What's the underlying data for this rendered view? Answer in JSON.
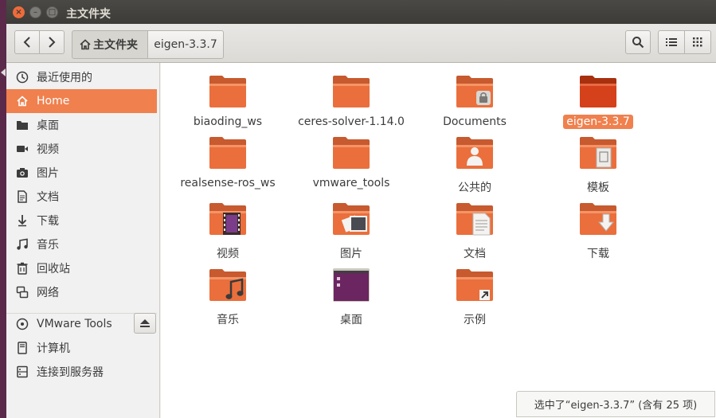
{
  "window": {
    "title": "主文件夹",
    "controls": {
      "close_glyph": "×",
      "minimize_glyph": "–",
      "maximize_glyph": "□"
    }
  },
  "toolbar": {
    "back_icon": "chevron-left-icon",
    "forward_icon": "chevron-right-icon",
    "breadcrumbs": [
      {
        "label": "主文件夹",
        "icon": "home-icon"
      },
      {
        "label": "eigen-3.3.7"
      }
    ],
    "search_icon": "search-icon",
    "list_view_icon": "list-view-icon",
    "grid_view_icon": "grid-view-icon"
  },
  "sidebar": {
    "items": [
      {
        "label": "最近使用的",
        "icon": "recent-icon"
      },
      {
        "label": "Home",
        "icon": "home-icon",
        "active": true
      },
      {
        "label": "桌面",
        "icon": "folder-icon"
      },
      {
        "label": "视频",
        "icon": "video-icon"
      },
      {
        "label": "图片",
        "icon": "camera-icon"
      },
      {
        "label": "文档",
        "icon": "document-icon"
      },
      {
        "label": "下载",
        "icon": "download-icon"
      },
      {
        "label": "音乐",
        "icon": "music-icon"
      },
      {
        "label": "回收站",
        "icon": "trash-icon"
      },
      {
        "label": "网络",
        "icon": "network-icon"
      }
    ],
    "devices": [
      {
        "label": "VMware Tools",
        "icon": "disc-icon"
      },
      {
        "label": "计算机",
        "icon": "computer-icon"
      },
      {
        "label": "连接到服务器",
        "icon": "server-icon"
      }
    ],
    "eject_icon": "eject-icon"
  },
  "files": [
    {
      "label": "biaoding_ws",
      "icon": "folder-icon"
    },
    {
      "label": "ceres-solver-1.14.0",
      "icon": "folder-icon"
    },
    {
      "label": "Documents",
      "icon": "locked-folder-icon"
    },
    {
      "label": "eigen-3.3.7",
      "icon": "folder-icon",
      "selected": true
    },
    {
      "label": "realsense-ros_ws",
      "icon": "folder-icon"
    },
    {
      "label": "vmware_tools",
      "icon": "folder-icon"
    },
    {
      "label": "公共的",
      "icon": "public-folder-icon"
    },
    {
      "label": "模板",
      "icon": "templates-folder-icon"
    },
    {
      "label": "视频",
      "icon": "videos-folder-icon"
    },
    {
      "label": "图片",
      "icon": "pictures-folder-icon"
    },
    {
      "label": "文档",
      "icon": "documents-folder-icon"
    },
    {
      "label": "下载",
      "icon": "downloads-folder-icon"
    },
    {
      "label": "音乐",
      "icon": "music-folder-icon"
    },
    {
      "label": "桌面",
      "icon": "desktop-folder-icon"
    },
    {
      "label": "示例",
      "icon": "examples-folder-icon"
    }
  ],
  "status": {
    "text": "选中了“eigen-3.3.7” (含有 25 项)"
  },
  "colors": {
    "accent": "#f0804e",
    "folder": "#ea6f3c",
    "selected_folder": "#d5411a",
    "titlebar": "#3c3b37"
  }
}
